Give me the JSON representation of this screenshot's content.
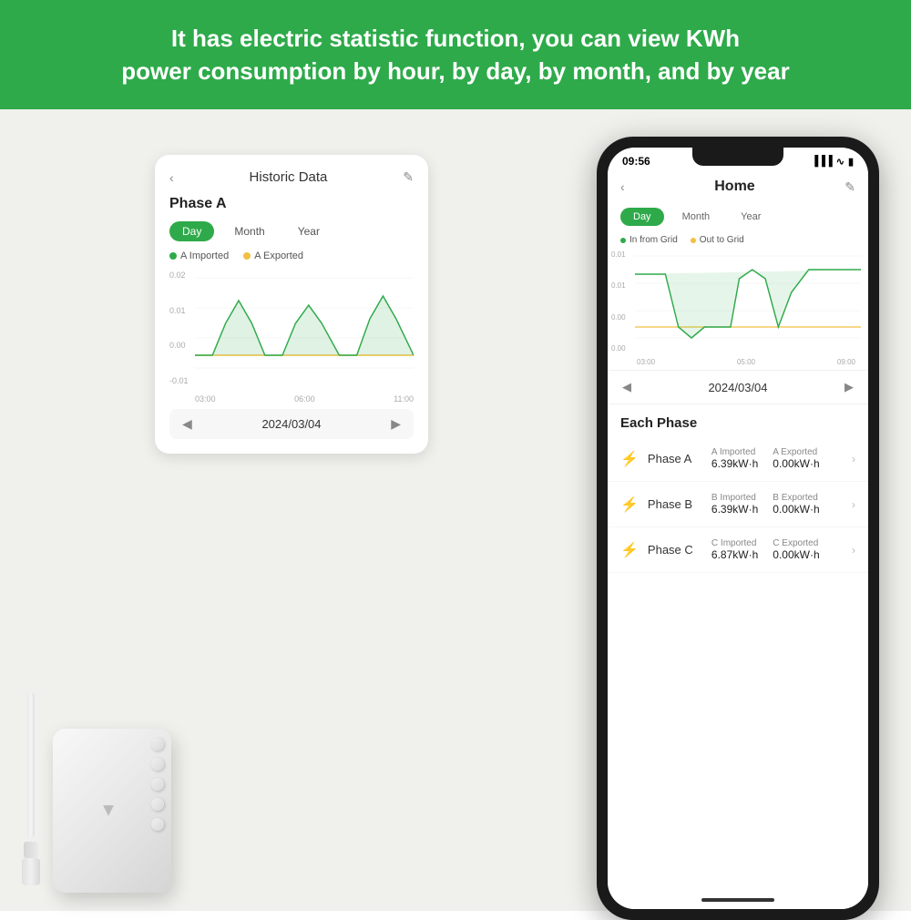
{
  "header": {
    "line1": "It has electric statistic function, you can view KWh",
    "line2": "power consumption by hour, by day, by month, and by year"
  },
  "left_card": {
    "title": "Historic Data",
    "phase_label": "Phase A",
    "tabs": [
      "Day",
      "Month",
      "Year"
    ],
    "active_tab": "Day",
    "legend": [
      {
        "label": "A Imported",
        "color": "green"
      },
      {
        "label": "A Exported",
        "color": "yellow"
      }
    ],
    "y_labels": [
      "0.02",
      "0.01",
      "0.00",
      "-0.01"
    ],
    "x_labels": [
      "03:00",
      "06:00",
      "11:00"
    ],
    "date": "2024/03/04"
  },
  "right_phone": {
    "status_time": "09:56",
    "app_title": "Home",
    "tabs": [
      "Day",
      "Month",
      "Year"
    ],
    "active_tab": "Day",
    "legend": [
      {
        "label": "In from Grid",
        "color": "green"
      },
      {
        "label": "Out to Grid",
        "color": "yellow"
      }
    ],
    "y_labels": [
      "0.01",
      "0.01",
      "0.00",
      "0.00"
    ],
    "x_labels": [
      "03:00",
      "05:00",
      "09:00"
    ],
    "date": "2024/03/04",
    "each_phase_title": "Each Phase",
    "phases": [
      {
        "name": "Phase A",
        "icon_color": "green",
        "imported_label": "A Imported",
        "imported_value": "6.39kW·h",
        "exported_label": "A Exported",
        "exported_value": "0.00kW·h"
      },
      {
        "name": "Phase B",
        "icon_color": "red",
        "imported_label": "B Imported",
        "imported_value": "6.39kW·h",
        "exported_label": "B Exported",
        "exported_value": "0.00kW·h"
      },
      {
        "name": "Phase C",
        "icon_color": "blue",
        "imported_label": "C Imported",
        "imported_value": "6.87kW·h",
        "exported_label": "C Exported",
        "exported_value": "0.00kW·h"
      }
    ]
  }
}
